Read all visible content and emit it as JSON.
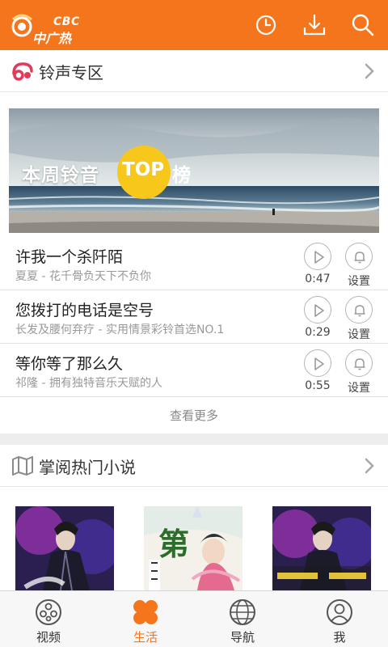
{
  "app": {
    "logo_en": "CBC",
    "logo_cn": "中广热点",
    "brand_color": "#f5751d"
  },
  "toolbar": {
    "history_icon": "clock-icon",
    "download_icon": "download-icon",
    "search_icon": "search-icon"
  },
  "ringtone_section": {
    "title": "铃声专区",
    "banner": {
      "text_prefix": "本周铃音",
      "text_highlight": "TOP",
      "text_suffix": "榜"
    },
    "songs": [
      {
        "title": "许我一个杀阡陌",
        "subtitle": "夏夏 - 花千骨负天下不负你",
        "duration": "0:47",
        "set_label": "设置"
      },
      {
        "title": "您拨打的电话是空号",
        "subtitle": "长发及腰何弃疗 - 实用情景彩铃首选NO.1",
        "duration": "0:29",
        "set_label": "设置"
      },
      {
        "title": "等你等了那么久",
        "subtitle": "祁隆 - 拥有独特音乐天赋的人",
        "duration": "0:55",
        "set_label": "设置"
      }
    ],
    "more_label": "查看更多"
  },
  "novel_section": {
    "title": "掌阅热门小说"
  },
  "bottom_nav": {
    "items": [
      {
        "label": "视频",
        "icon": "video-icon",
        "active": false
      },
      {
        "label": "生活",
        "icon": "life-icon",
        "active": true
      },
      {
        "label": "导航",
        "icon": "globe-icon",
        "active": false
      },
      {
        "label": "我",
        "icon": "profile-icon",
        "active": false
      }
    ]
  }
}
